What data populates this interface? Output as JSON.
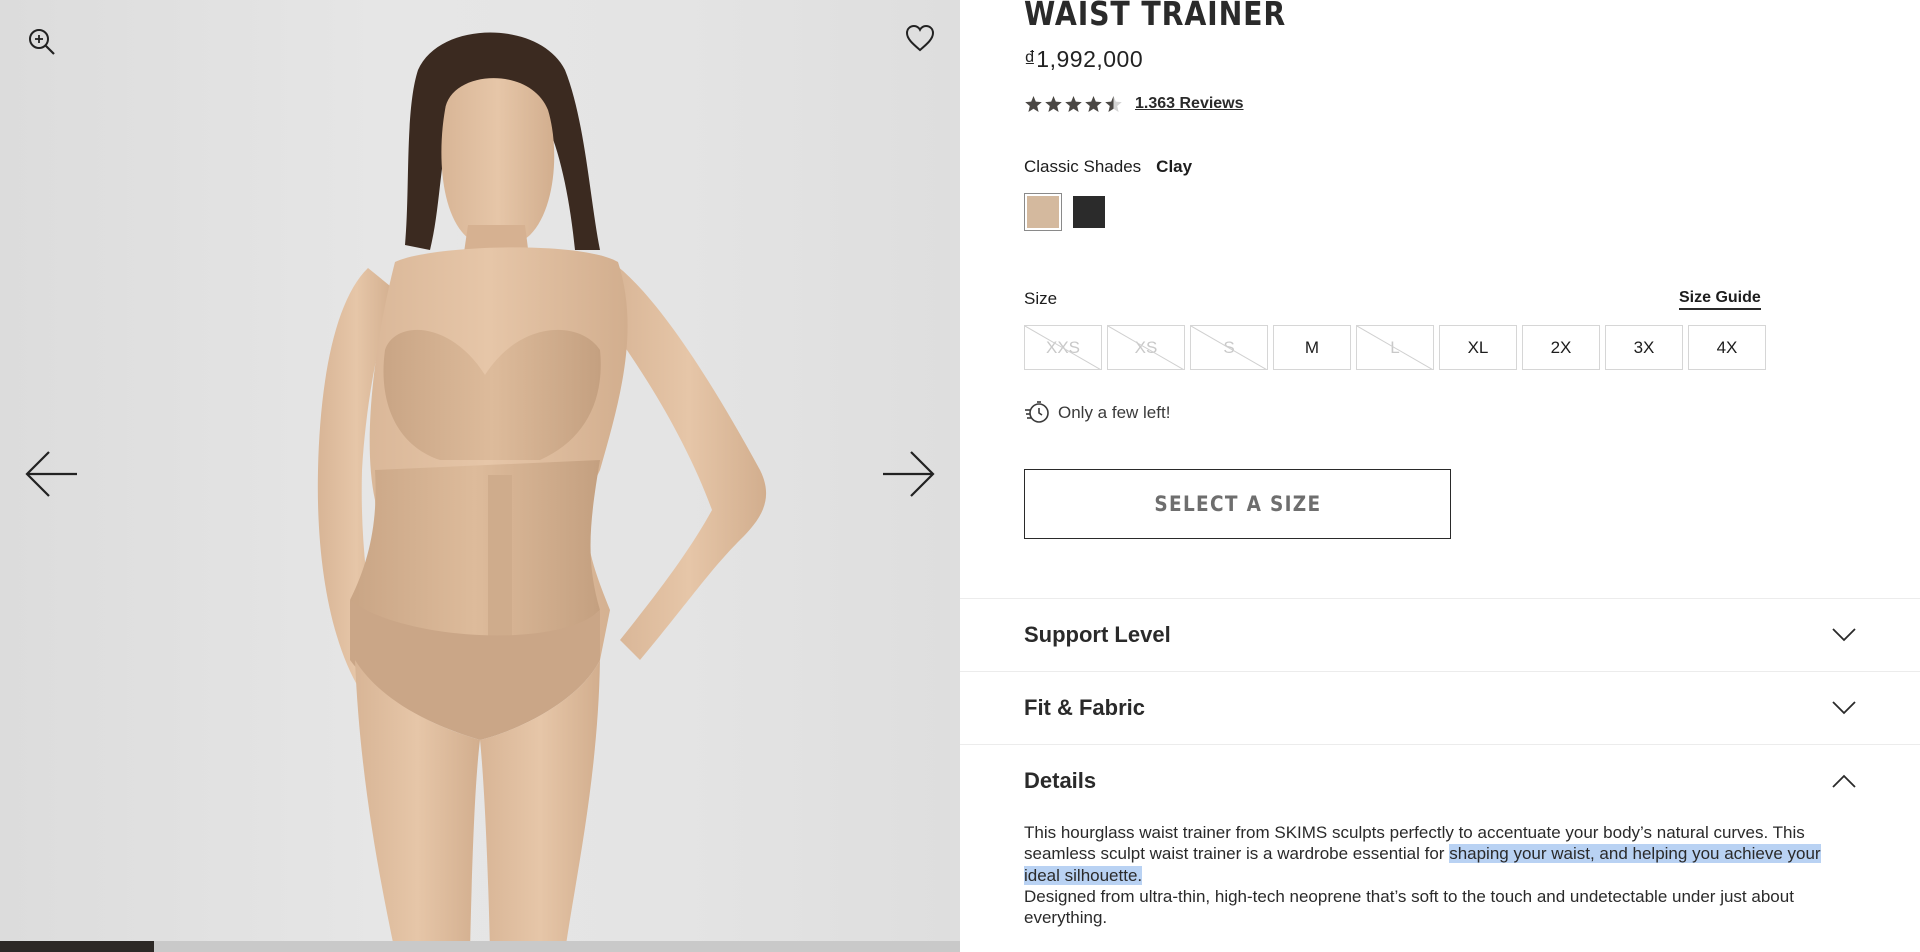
{
  "gallery": {
    "zoom_icon": "zoom-in-icon",
    "wishlist_icon": "heart-icon",
    "prev_icon": "arrow-left-icon",
    "next_icon": "arrow-right-icon",
    "progress_fraction": 0.16
  },
  "product": {
    "title": "WAIST TRAINER",
    "price": "₫1,992,000",
    "rating_value": 4.5,
    "reviews_label": "1.363 Reviews"
  },
  "shade": {
    "label": "Classic Shades",
    "selected": "Clay",
    "swatches": [
      {
        "name": "Clay",
        "color": "#d4b99e"
      },
      {
        "name": "Black",
        "color": "#2b2b2b"
      }
    ]
  },
  "size": {
    "label": "Size",
    "guide_label": "Size Guide",
    "options": [
      {
        "label": "XXS",
        "available": false
      },
      {
        "label": "XS",
        "available": false
      },
      {
        "label": "S",
        "available": false
      },
      {
        "label": "M",
        "available": true
      },
      {
        "label": "L",
        "available": false
      },
      {
        "label": "XL",
        "available": true
      },
      {
        "label": "2X",
        "available": true
      },
      {
        "label": "3X",
        "available": true
      },
      {
        "label": "4X",
        "available": true
      }
    ]
  },
  "stock": {
    "icon": "clock-fast-icon",
    "message": "Only a few left!"
  },
  "cta": {
    "label": "SELECT A SIZE"
  },
  "accordions": [
    {
      "title": "Support Level",
      "expanded": false
    },
    {
      "title": "Fit & Fabric",
      "expanded": false
    },
    {
      "title": "Details",
      "expanded": true
    }
  ],
  "details": {
    "line1": "This hourglass waist trainer from SKIMS sculpts perfectly to accentuate your body’s natural curves. This seamless sculpt waist trainer is a wardrobe essential for ",
    "highlighted": "shaping your waist, and helping you achieve your ideal silhouette.",
    "line2": "Designed from ultra-thin, high-tech neoprene that’s soft to the touch and undetectable under just about everything."
  }
}
